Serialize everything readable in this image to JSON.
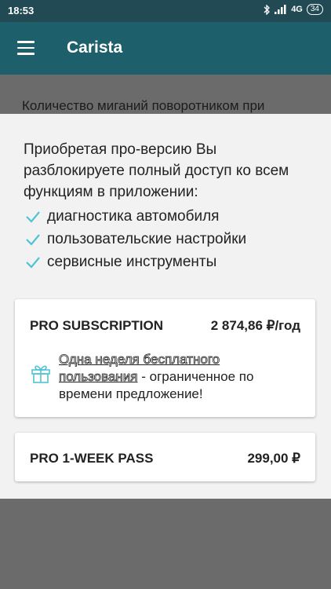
{
  "status_bar": {
    "time": "18:53",
    "network": "4G",
    "battery": "34"
  },
  "app_bar": {
    "title": "Carista",
    "menu_icon": "hamburger-menu-icon"
  },
  "background": {
    "text": "Количество миганий поворотником при"
  },
  "upgrade": {
    "intro": "Приобретая про-версию Вы разблокируете полный доступ ко всем функциям в приложении:",
    "features": [
      {
        "label": "диагностика автомобиля",
        "icon": "check-icon"
      },
      {
        "label": "пользовательские настройки",
        "icon": "check-icon"
      },
      {
        "label": "сервисные инструменты",
        "icon": "check-icon"
      }
    ],
    "plans": {
      "subscription": {
        "name": "PRO SUBSCRIPTION",
        "price": "2 874,86 ₽/год",
        "promo_highlight": "Одна неделя бесплатного пользования",
        "promo_rest": " - ограниченное по времени предложение!",
        "promo_icon": "gift-icon"
      },
      "week_pass": {
        "name": "PRO 1-WEEK PASS",
        "price": "299,00 ₽"
      }
    }
  },
  "colors": {
    "status_bar": "#214a55",
    "app_bar": "#1d5f6a",
    "accent_check": "#4fc3d4",
    "sheet": "#f2f2f2"
  }
}
